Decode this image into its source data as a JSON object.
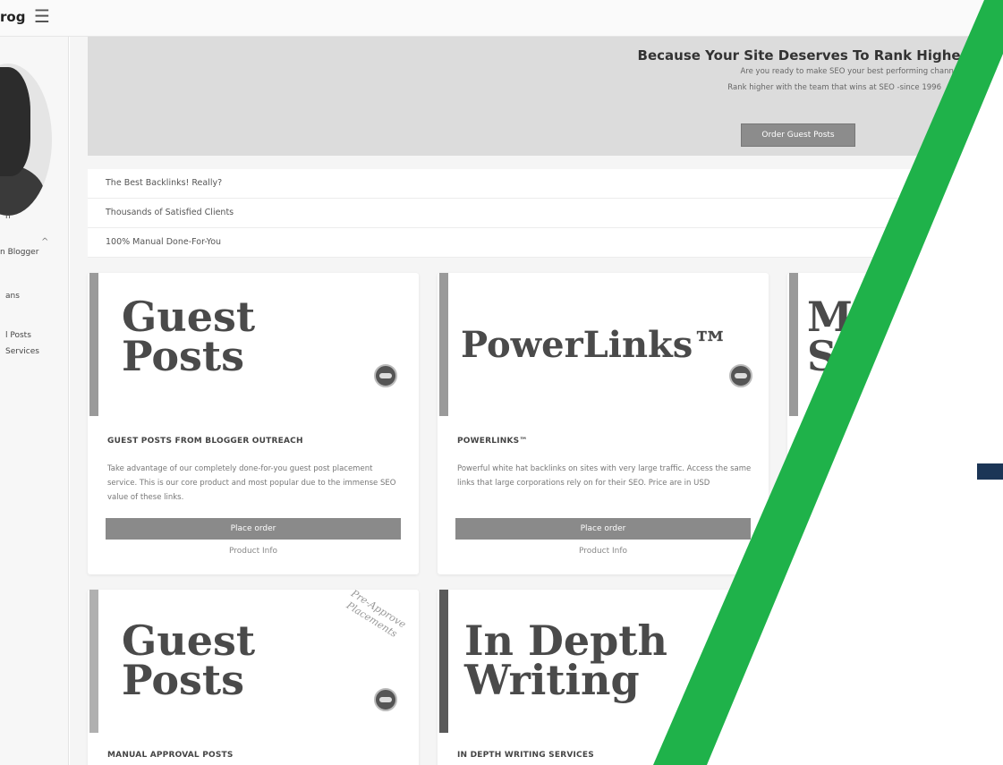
{
  "topbar": {
    "brand": "rog"
  },
  "sidebar": {
    "items": [
      "n",
      "n Blogger",
      "ans",
      "l Posts",
      "Services"
    ]
  },
  "hero": {
    "title": "Because Your Site Deserves To Rank Higher™",
    "subtitle1": "Are you ready to make SEO your best performing channel?",
    "subtitle2": "Rank higher with the team that wins at SEO -since 1996",
    "button": "Order Guest Posts"
  },
  "features": [
    "The Best Backlinks! Really?",
    "Thousands of Satisfied Clients",
    "100% Manual Done-For-You"
  ],
  "cards": [
    {
      "big_line1": "Guest",
      "big_line2": "Posts",
      "heading": "GUEST POSTS FROM BLOGGER OUTREACH",
      "desc": "Take advantage of our completely done-for-you guest post placement service. This is our core product and most popular due to the immense SEO value of these links.",
      "order": "Place order",
      "info": "Product Info"
    },
    {
      "big_line1": "PowerLinks™",
      "heading": "POWERLINKS™",
      "desc": "Powerful white hat backlinks on sites with very large traffic. Access the same links that large corporations rely on for their SEO. Price are in USD",
      "order": "Place order",
      "info": "Product Info"
    },
    {
      "big_line1": "M",
      "big_line2": "S"
    },
    {
      "big_line1": "Guest",
      "big_line2": "Posts",
      "stamp": "Pre-Approve Placements",
      "heading": "MANUAL APPROVAL POSTS"
    },
    {
      "big_line1": "In Depth",
      "big_line2": "Writing",
      "heading": "IN DEPTH WRITING SERVICES"
    }
  ],
  "colors": {
    "accent_green": "#1fb24a",
    "navy": "#1b3556"
  }
}
